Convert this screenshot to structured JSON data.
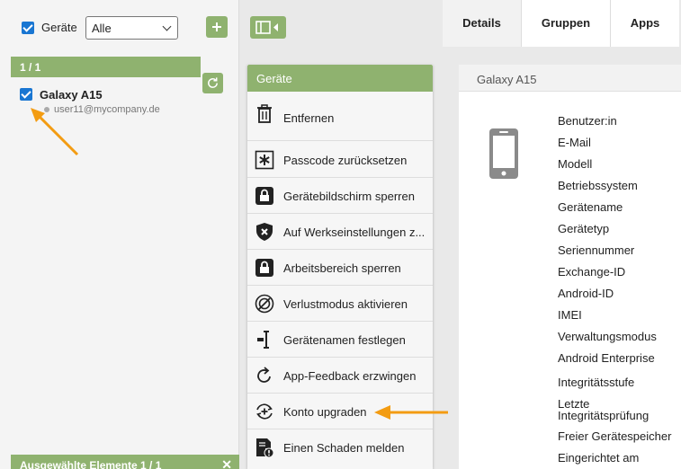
{
  "left": {
    "filter_label": "Geräte",
    "filter_select": "Alle",
    "count": "1 / 1",
    "device": {
      "name": "Galaxy A15",
      "user": "user11@mycompany.de"
    },
    "selected_footer": "Ausgewählte Elemente  1 / 1",
    "close_glyph": "✕"
  },
  "menu": {
    "header": "Geräte",
    "items": [
      {
        "label": "Entfernen",
        "icon": "trash-icon"
      },
      {
        "label": "Passcode zurücksetzen",
        "icon": "asterisk-icon"
      },
      {
        "label": "Gerätebildschirm sperren",
        "icon": "lock-icon"
      },
      {
        "label": "Auf Werkseinstellungen z...",
        "icon": "shield-x-icon"
      },
      {
        "label": "Arbeitsbereich sperren",
        "icon": "lock-icon"
      },
      {
        "label": "Verlustmodus aktivieren",
        "icon": "radar-icon"
      },
      {
        "label": "Gerätenamen festlegen",
        "icon": "rename-icon"
      },
      {
        "label": "App-Feedback erzwingen",
        "icon": "refresh-icon"
      },
      {
        "label": "Konto upgraden",
        "icon": "upgrade-icon"
      },
      {
        "label": "Einen Schaden melden",
        "icon": "report-damage-icon"
      }
    ]
  },
  "tabs": [
    "Details",
    "Gruppen",
    "Apps"
  ],
  "details": {
    "device_title": "Galaxy A15",
    "fields": [
      "Benutzer:in",
      "E-Mail",
      "Modell",
      "Betriebssystem",
      "Gerätename",
      "Gerätetyp",
      "Seriennummer",
      "Exchange-ID",
      "Android-ID",
      "IMEI",
      "Verwaltungsmodus",
      "Android Enterprise",
      "Integritätsstufe",
      "Letzte Integritätsprüfung",
      "Freier Gerätespeicher",
      "Eingerichtet am"
    ]
  },
  "colors": {
    "accent_green": "#8fb26f",
    "checkbox_blue": "#1976d2",
    "annotation_arrow": "#f39c12"
  }
}
